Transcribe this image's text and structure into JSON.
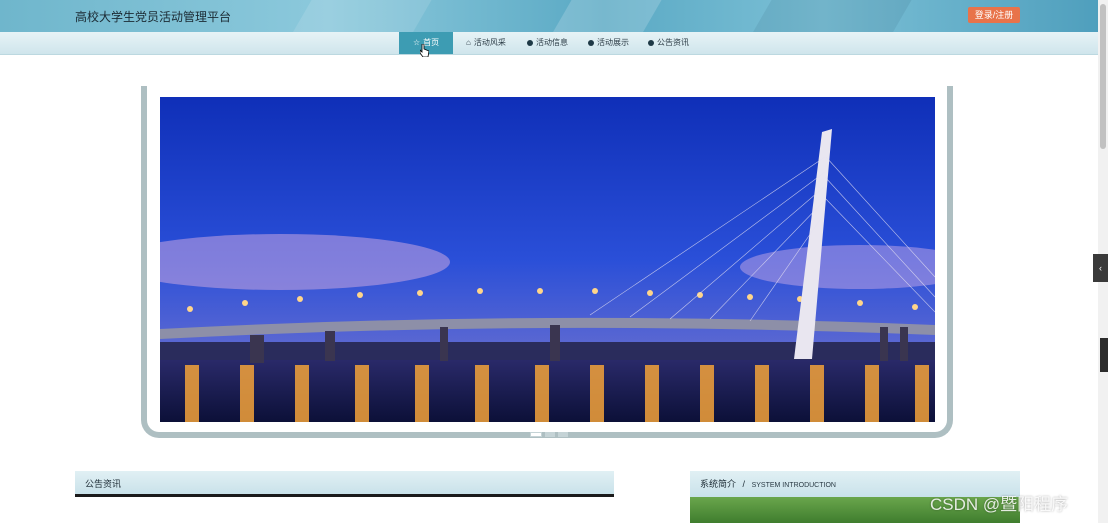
{
  "header": {
    "title": "高校大学生党员活动管理平台",
    "login_label": "登录/注册",
    "bg_color": "#6fb6cc",
    "login_color": "#e8734a"
  },
  "nav": {
    "items": [
      {
        "label": "首页",
        "icon": "star-icon",
        "active": true
      },
      {
        "label": "活动风采",
        "icon": "home-icon",
        "active": false
      },
      {
        "label": "活动信息",
        "icon": "info-icon",
        "active": false
      },
      {
        "label": "活动展示",
        "icon": "info-icon",
        "active": false
      },
      {
        "label": "公告资讯",
        "icon": "info-icon",
        "active": false
      }
    ],
    "active_color": "#3d9cb3"
  },
  "slider": {
    "image": "bridge-night-photo",
    "prev_icon": "chevron-left-icon",
    "next_icon": "chevron-right-icon",
    "slide_count": 3,
    "active_slide": 1
  },
  "sections": {
    "notice": {
      "title": "公告资讯"
    },
    "intro": {
      "title": "系统简介",
      "separator": "/",
      "subtitle": "SYSTEM INTRODUCTION"
    }
  },
  "side_tab": {
    "icon": "chevron-left-icon"
  },
  "watermark": "CSDN @暨阳程序"
}
